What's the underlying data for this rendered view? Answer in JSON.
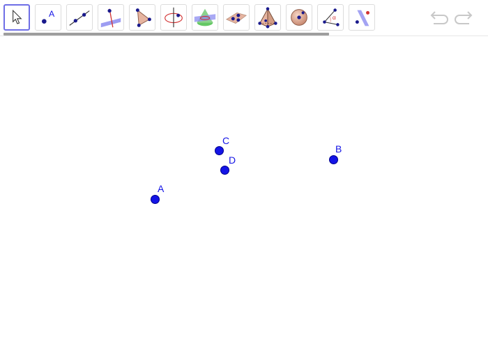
{
  "toolbar": {
    "tools": [
      {
        "name": "move-tool",
        "icon": "cursor-arrow-icon",
        "active": true
      },
      {
        "name": "point-tool",
        "icon": "point-a-icon",
        "active": false,
        "icon_label": "A"
      },
      {
        "name": "line-tool",
        "icon": "line-through-points-icon",
        "active": false
      },
      {
        "name": "perpendicular-line-tool",
        "icon": "perpendicular-plane-icon",
        "active": false
      },
      {
        "name": "polygon-tool",
        "icon": "triangle-polygon-icon",
        "active": false
      },
      {
        "name": "circle-axis-tool",
        "icon": "circle-around-axis-icon",
        "active": false
      },
      {
        "name": "intersect-surfaces-tool",
        "icon": "cone-intersection-icon",
        "active": false
      },
      {
        "name": "plane-tool",
        "icon": "plane-three-points-icon",
        "active": false
      },
      {
        "name": "pyramid-tool",
        "icon": "pyramid-icon",
        "active": false
      },
      {
        "name": "sphere-tool",
        "icon": "sphere-center-point-icon",
        "active": false
      },
      {
        "name": "angle-tool",
        "icon": "angle-icon",
        "active": false,
        "icon_label": "α"
      },
      {
        "name": "reflect-tool",
        "icon": "reflect-about-plane-icon",
        "active": false
      }
    ],
    "undo_icon": "undo-icon",
    "redo_icon": "redo-icon"
  },
  "points": [
    {
      "id": "A",
      "label": "A"
    },
    {
      "id": "B",
      "label": "B"
    },
    {
      "id": "C",
      "label": "C"
    },
    {
      "id": "D",
      "label": "D"
    }
  ],
  "colors": {
    "point_fill": "#1414e6",
    "point_stroke": "#00008c",
    "label": "#1414e6",
    "active_tool_border": "#6e6ee6",
    "scrollbar": "#9e9e9e",
    "undo_redo_disabled": "#c8c8c8"
  }
}
